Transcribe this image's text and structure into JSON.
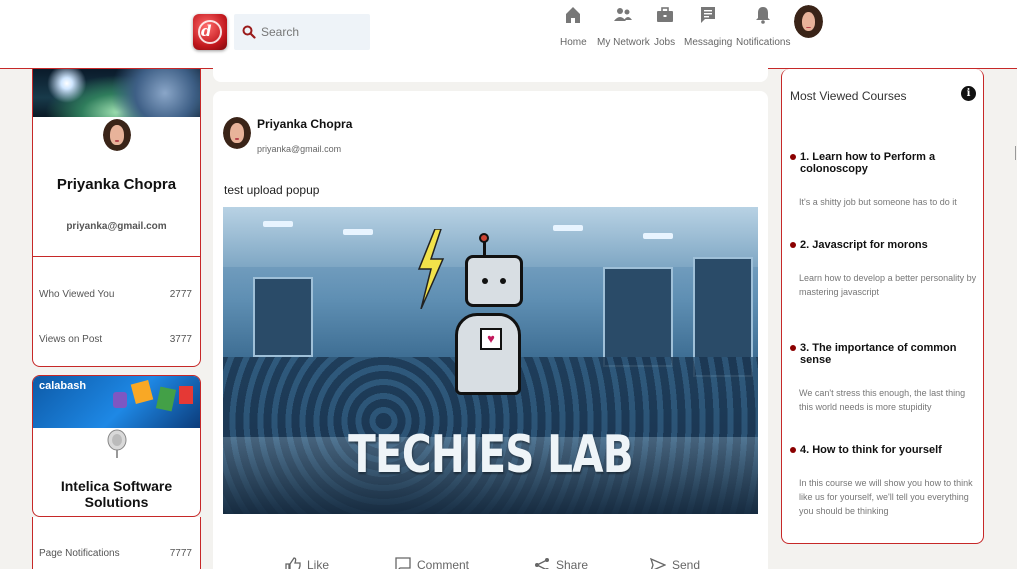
{
  "header": {
    "search_placeholder": "Search",
    "nav": [
      {
        "label": "Home",
        "icon": "home-icon"
      },
      {
        "label": "My Network",
        "icon": "people-icon"
      },
      {
        "label": "Jobs",
        "icon": "briefcase-icon"
      },
      {
        "label": "Messaging",
        "icon": "message-icon"
      },
      {
        "label": "Notifications",
        "icon": "bell-icon"
      }
    ]
  },
  "profile": {
    "name": "Priyanka Chopra",
    "email": "priyanka@gmail.com",
    "stats": [
      {
        "label": "Who Viewed You",
        "value": "2777"
      },
      {
        "label": "Views on Post",
        "value": "3777"
      }
    ]
  },
  "company": {
    "banner_text": "calabash",
    "name": "Intelica Software Solutions",
    "stats": [
      {
        "label": "Page Notifications",
        "value": "7777"
      }
    ]
  },
  "post": {
    "author": "Priyanka Chopra",
    "email": "priyanka@gmail.com",
    "text": "test upload popup",
    "image_caption": "TECHIES LAB",
    "actions": [
      "Like",
      "Comment",
      "Share",
      "Send"
    ]
  },
  "courses": {
    "title": "Most Viewed Courses",
    "items": [
      {
        "title": "1. Learn how to Perform a colonoscopy",
        "desc": "It's a shitty job but someone has to do it"
      },
      {
        "title": "2. Javascript for morons",
        "desc": "Learn how to develop a better personality by mastering javascript"
      },
      {
        "title": "3. The importance of common sense",
        "desc": "We can't stress this enough, the last thing this world needs is more stupidity"
      },
      {
        "title": "4. How to think for yourself",
        "desc": "In this course we will show you how to think like us for yourself, we'll tell you everything you should be thinking"
      }
    ]
  },
  "colors": {
    "accent": "#c62828",
    "bullet": "#8b0000"
  }
}
